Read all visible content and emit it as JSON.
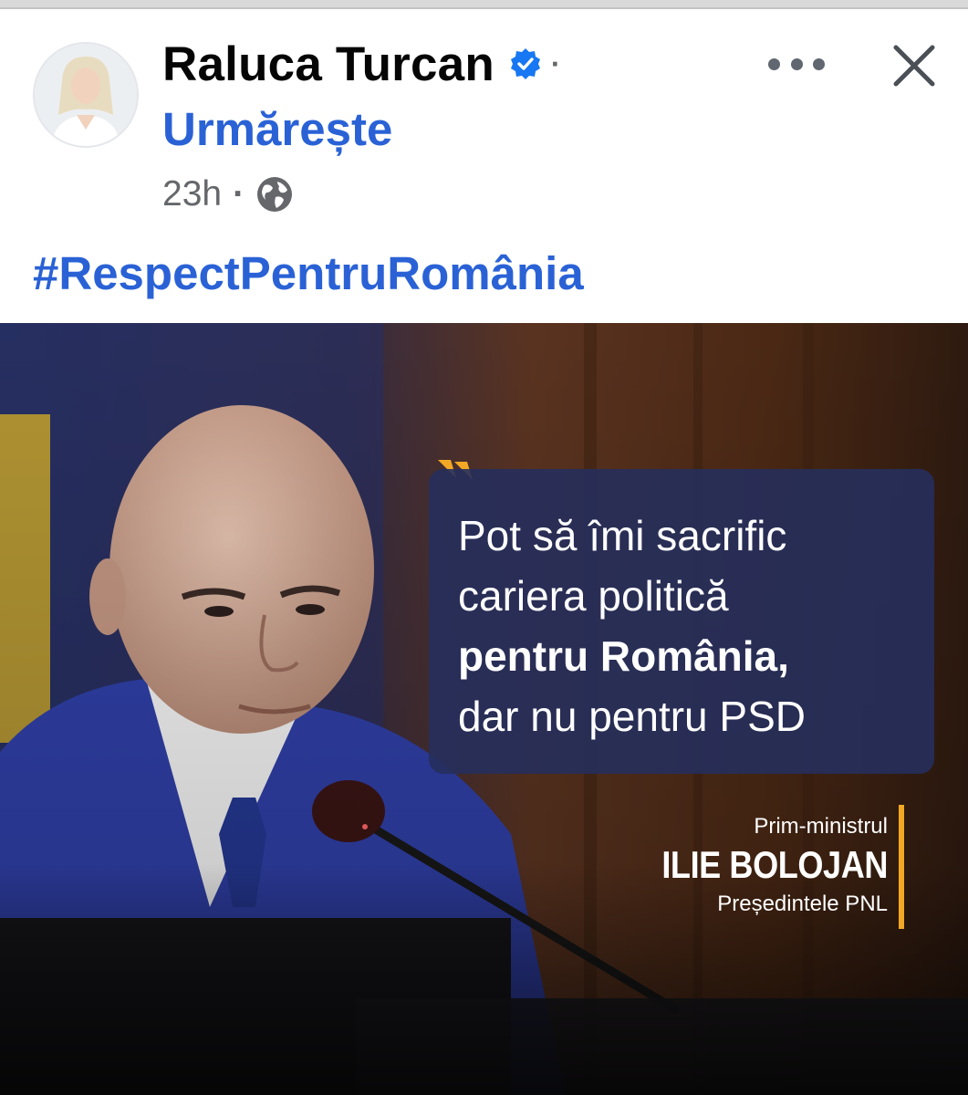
{
  "post": {
    "author": "Raluca Turcan",
    "follow_label": "Urmărește",
    "dot_separator": "·",
    "time": "23h",
    "hashtag": "#RespectPentruRomânia"
  },
  "icons": {
    "verified": "verified-badge-icon",
    "audience": "globe-icon",
    "more": "more-options-icon",
    "close": "close-icon"
  },
  "colors": {
    "link_blue": "#2a62d6",
    "verified_blue": "#1877f2",
    "muted": "#65676b",
    "quote_bg": "#262f5c",
    "accent_yellow": "#f2a825"
  },
  "image": {
    "quote_lines": [
      "Pot să îmi sacrific",
      "cariera politică",
      "pentru România,",
      "dar nu pentru PSD"
    ],
    "title": "Prim-ministrul",
    "name": "ILIE BOLOJAN",
    "role": "Președintele PNL"
  }
}
